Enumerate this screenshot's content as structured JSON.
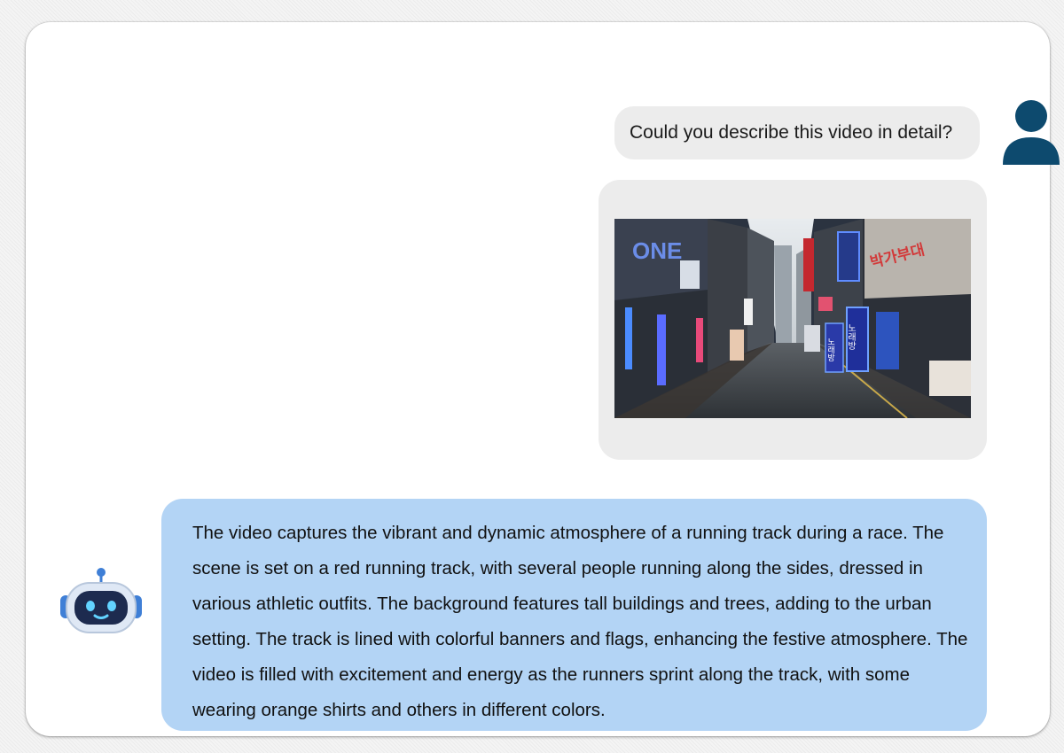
{
  "conversation": {
    "user_message": {
      "text": "Could you describe this video in detail?",
      "avatar_icon": "user-silhouette-icon",
      "bubble_color": "#ececec"
    },
    "user_video": {
      "thumbnail": {
        "signs": {
          "one": "ONE",
          "building_right": "박가부대",
          "noraebang_1": "노래방",
          "noraebang_2": "노래방"
        }
      }
    },
    "assistant_message": {
      "avatar_icon": "robot-icon",
      "bubble_color": "#b3d4f5",
      "text": "The video captures the vibrant and dynamic atmosphere of a running track during a race. The scene is set on a red running track, with several people running along the sides, dressed in various athletic outfits. The background features tall buildings and trees, adding to the urban setting. The track is lined with colorful banners and flags, enhancing the festive atmosphere. The video is filled with excitement and energy as the runners sprint along the track, with some wearing orange shirts and others in different colors."
    }
  },
  "colors": {
    "user_avatar": "#0d4a6e",
    "card_background": "#ffffff"
  }
}
